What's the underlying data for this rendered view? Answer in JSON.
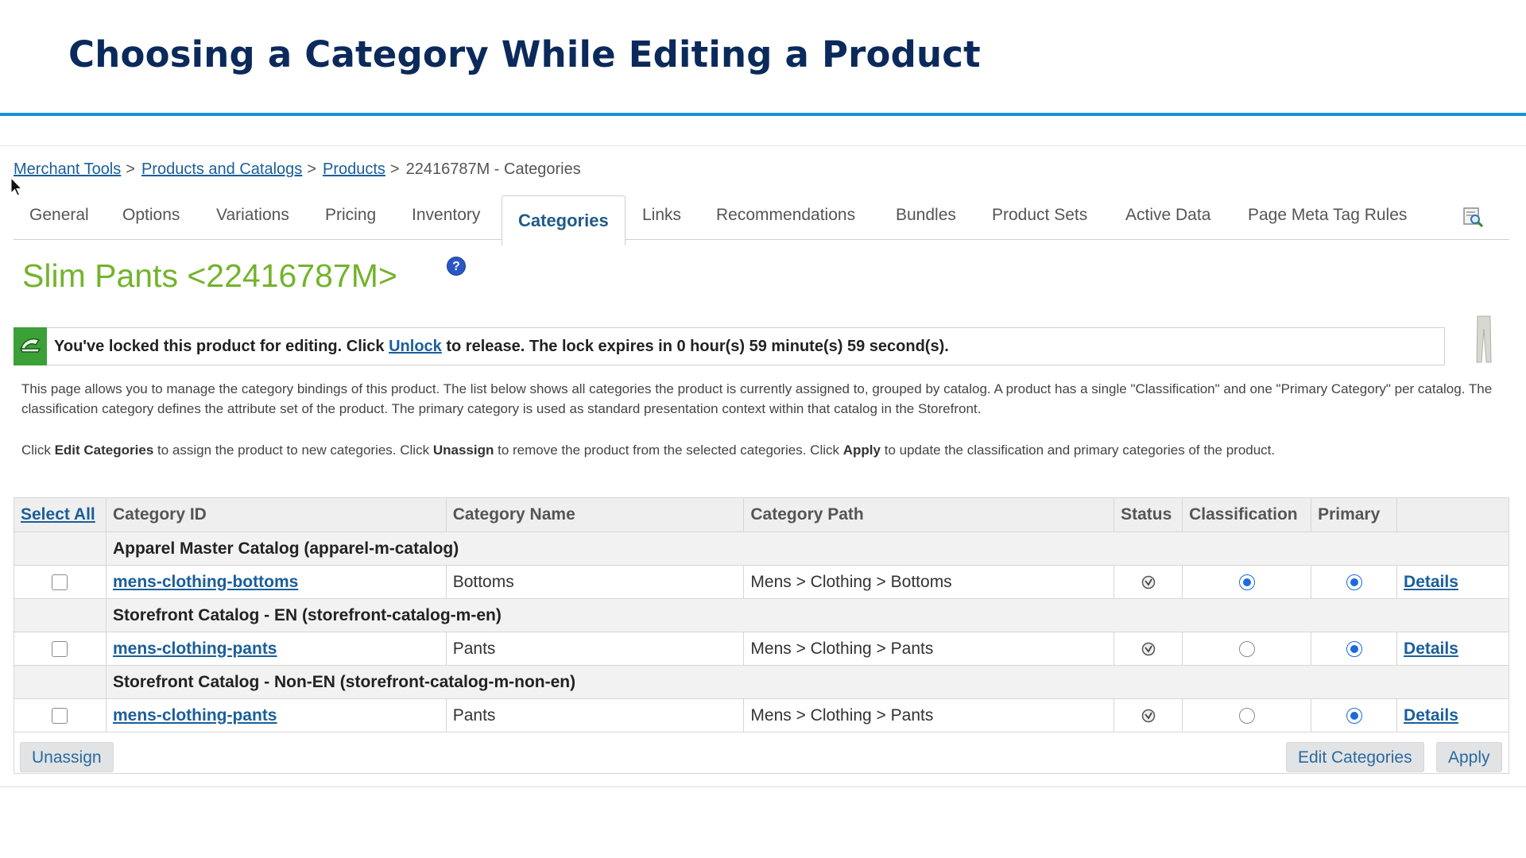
{
  "slide": {
    "title": "Choosing a Category While Editing a Product"
  },
  "breadcrumb": {
    "items": [
      "Merchant Tools",
      "Products and Catalogs",
      "Products"
    ],
    "current": "22416787M - Categories",
    "separator": ">"
  },
  "tabs": [
    "General",
    "Options",
    "Variations",
    "Pricing",
    "Inventory",
    "Categories",
    "Links",
    "Recommendations",
    "Bundles",
    "Product Sets",
    "Active Data",
    "Page Meta Tag Rules"
  ],
  "active_tab": "Categories",
  "product": {
    "title": "Slim Pants <22416787M>",
    "help": "?"
  },
  "lock": {
    "before": "You've locked this product for editing. Click",
    "link": "Unlock",
    "after": "to release. The lock expires in 0 hour(s) 59 minute(s) 59 second(s)."
  },
  "description": {
    "p1": "This page allows you to manage the category bindings of this product. The list below shows all categories the product is currently assigned to, grouped by catalog. A product has a single \"Classification\" and one \"Primary Category\" per catalog. The classification category defines the attribute set of the product. The primary category is used as standard presentation context within that catalog in the Storefront.",
    "p2_a": "Click",
    "p2_edit": "Edit Categories",
    "p2_b": "to assign the product to new categories. Click",
    "p2_unassign": "Unassign",
    "p2_c": "to remove the product from the selected categories. Click",
    "p2_apply": "Apply",
    "p2_d": "to update the classification and primary categories of the product."
  },
  "table": {
    "headers": {
      "select_all": "Select All",
      "category_id": "Category ID",
      "category_name": "Category Name",
      "category_path": "Category Path",
      "status": "Status",
      "classification": "Classification",
      "primary": "Primary"
    },
    "groups": [
      {
        "catalog": "Apparel Master Catalog (apparel-m-catalog)",
        "row": {
          "id": "mens-clothing-bottoms",
          "name": "Bottoms",
          "path": "Mens > Clothing > Bottoms",
          "classification": true,
          "primary": true,
          "details": "Details"
        }
      },
      {
        "catalog": "Storefront Catalog - EN (storefront-catalog-m-en)",
        "row": {
          "id": "mens-clothing-pants",
          "name": "Pants",
          "path": "Mens > Clothing > Pants",
          "classification": false,
          "primary": true,
          "details": "Details"
        }
      },
      {
        "catalog": "Storefront Catalog - Non-EN (storefront-catalog-m-non-en)",
        "row": {
          "id": "mens-clothing-pants",
          "name": "Pants",
          "path": "Mens > Clothing > Pants",
          "classification": false,
          "primary": true,
          "details": "Details"
        }
      }
    ]
  },
  "buttons": {
    "unassign": "Unassign",
    "edit_categories": "Edit Categories",
    "apply": "Apply"
  },
  "colors": {
    "title": "#0b2a5b",
    "rule": "#1691d6",
    "product_title": "#73b32c",
    "link": "#1a5e9a",
    "lock_green": "#3aa037"
  }
}
